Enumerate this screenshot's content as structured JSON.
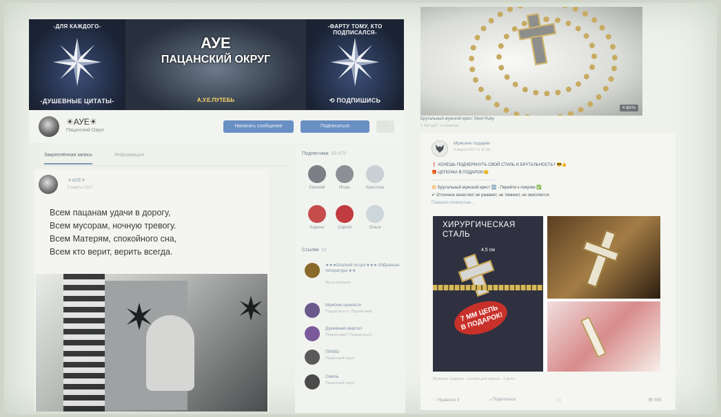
{
  "banner": {
    "left_top": "-ДЛЯ КАЖДОГО-",
    "left_bottom": "-ДУШЕВНЫЕ ЦИТАТЫ-",
    "center_title": "АУЕ",
    "center_subtitle": "ПАЦАНСКИЙ ОКРУГ",
    "center_tag": "А.У.Е.ПУТЕБЬ",
    "right_top": "-ФАРТУ ТОМУ, КТО ПОДПИСАЛСЯ-",
    "right_bottom": "⟲ ПОДПИШИСЬ"
  },
  "group": {
    "name": "☀АУЕ☀",
    "status": "Пацанский Округ",
    "btn_message": "Написать сообщение",
    "btn_subscribe": "Подписаться",
    "btn_more": "···"
  },
  "tabs": [
    "Закреплённая запись",
    "Информация"
  ],
  "post": {
    "author": "☀АУЕ☀",
    "date": "5 марта 2017",
    "lines": [
      "Всем пацанам удачи в дорогу,",
      "Всем мусорам, ночную тревогу.",
      "Всем Матерям, спокойного сна,",
      "Всем кто верит, верить всегда."
    ]
  },
  "members": {
    "title": "Подписчики",
    "count": "53 475",
    "items": [
      {
        "name": "Евгений",
        "color": "#7c7f86"
      },
      {
        "name": "Игорь",
        "color": "#8c8f93"
      },
      {
        "name": "Кристина",
        "color": "#c9d0d4"
      },
      {
        "name": "Карина",
        "color": "#c64c4c"
      },
      {
        "name": "Сергей",
        "color": "#c03c40"
      },
      {
        "name": "Ольга",
        "color": "#cdd6da"
      }
    ]
  },
  "contacts": {
    "title": "Ссылки",
    "count": "11",
    "items": [
      {
        "title": "★★★Блатной острог★★★ Избранная литература ★★",
        "sub": "Мы в контакте",
        "color": "#8a6a2a"
      },
      {
        "title": "Мужские ценности",
        "sub": "Подписаться / Подписчики",
        "color": "#6a5a8c"
      },
      {
        "title": "Душевный квартал",
        "sub": "Подписчики / Подписаться",
        "color": "#7a5a9a"
      },
      {
        "title": "ПРАВО",
        "sub": "Пацанский округ",
        "color": "#5a5a5a"
      },
      {
        "title": "Сквозь",
        "sub": "Пацанский округ",
        "color": "#4a4a4a"
      }
    ]
  },
  "product": {
    "badge": "4 фото",
    "title": "Брутальный мужской крест Steel Ruby",
    "subtitle": "1 490 руб · в наличии"
  },
  "feed": {
    "name": "Мужские подарки",
    "date": "5 марта 2017 в 11:09",
    "lines": [
      {
        "text": "❗ ХОЧЕШЬ ПОДЧЕРКНУТЬ СВОЙ СТИЛЬ И БРУТАЛЬНОСТЬ? 😎👍",
        "color": "#4a5966"
      },
      {
        "text": "🎁 ЦЕПОЧКА В ПОДАРОК!😊",
        "color": "#4a5966"
      },
      {
        "text": "- - - - - - - - - - - - - - - - - - - - - - - - - -",
        "color": "#4a8ac4"
      },
      {
        "text": "🔆 Брутальный мужской крест 🆕 - Перейти к покупке ✅",
        "color": "#4a5966"
      },
      {
        "text": "✔ Отличное качество! не ржавеет, не темнеет, не окисляется",
        "color": "#4a5966"
      },
      {
        "text": "Показать полностью…",
        "color": "#8fa6bd"
      }
    ],
    "collage_head": [
      "ХИРУРГИЧЕСКАЯ",
      "СТАЛЬ"
    ],
    "collage_measure": "4,5 см",
    "collage_chain": [
      "7 ММ ЦЕПЬ",
      "В ПОДАРОК!"
    ],
    "caption": "Мужские подарки · ссылка для заказа · 1 фото",
    "actions": {
      "like": "♡ Нравится 9",
      "share": "⤷ Поделиться",
      "comments": "▢",
      "views": "👁 55К"
    }
  }
}
